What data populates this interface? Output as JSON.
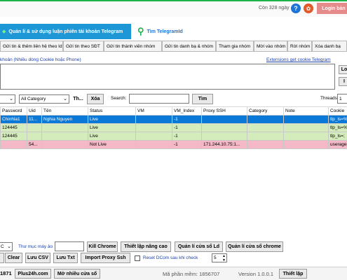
{
  "top": {
    "days_left": "Còn 328 ngày",
    "login_label": "Login bản"
  },
  "nav": {
    "manage_label": "Quản lí & sử dụng luận phiên tài khoản Telegram",
    "find_label": "Tìm TelegramId"
  },
  "tabs": [
    "Gửi tin & thêm liên hệ theo Id",
    "Gửi tin theo SĐT",
    "Gửi tin thành viên nhóm",
    "Gửi tin danh bạ & nhóm",
    "Tham gia nhóm",
    "Mời vào nhóm",
    "Rời nhóm",
    "Xóa danh bạ"
  ],
  "cookie": {
    "label": "khoản (Nhiều dòng Cookie hoặc Phone)",
    "link": "Extensions get cookie Telegram",
    "side_btn1": "Lo",
    "side_btn2": "I"
  },
  "filter": {
    "category": "All Category",
    "th_btn": "Th...",
    "delete_btn": "Xóa",
    "search_label": "Search:",
    "find_btn": "Tìm",
    "threads_label": "Threads",
    "threads_value": "1"
  },
  "table": {
    "headers": [
      "Password",
      "Uid",
      "Tên",
      "Status",
      "VM",
      "VM_Index",
      "Proxy SSH",
      "Category",
      "Note",
      "Cookie"
    ],
    "rows": [
      [
        "Chinhla1",
        "11...",
        "Nghia Nguyen",
        "Live",
        "",
        "-1",
        "",
        "",
        "",
        "tlp_ls=%"
      ],
      [
        "124445",
        "",
        "",
        "Live",
        "",
        "-1",
        "",
        "",
        "",
        "tlp_ls=%"
      ],
      [
        "124445",
        "",
        "",
        "Live",
        "",
        "-1",
        "",
        "",
        "",
        "tlp_ls=;"
      ],
      [
        "",
        "54...",
        "",
        "Not Live",
        "",
        "-1",
        "171.244.10.75:1...",
        "",
        "",
        "useragen"
      ]
    ]
  },
  "bottom1": {
    "dropdown": "C",
    "folder_label": "Thư mục máy ảo",
    "kill_chrome": "Kill Chrome",
    "advanced_settings": "Thiết lập nâng cao",
    "chrome_window_ld": "Quản lí cửa sổ Ld",
    "chrome_window": "Quản lí cửa sổ chrome"
  },
  "bottom2": {
    "clear": "Clear",
    "save_csv": "Lưu CSV",
    "save_txt": "Lưu Txt",
    "import_proxy": "Import Proxy Ssh",
    "reset_label": "Reset DCom sau khi check",
    "reset_value": "5"
  },
  "footer": {
    "number": "1871",
    "site": "Plus24h.com",
    "multi_window": "Mở nhiều cửa sổ",
    "software_code": "Mã phần mềm: 1856707",
    "version": "Version 1.0.0.1",
    "settings": "Thiết lập"
  },
  "colors": {
    "selected_row": "#0a78d7",
    "live_row": "#d4ebbb",
    "not_live_row": "#f4b8c6",
    "accent_blue": "#1e73d6"
  }
}
